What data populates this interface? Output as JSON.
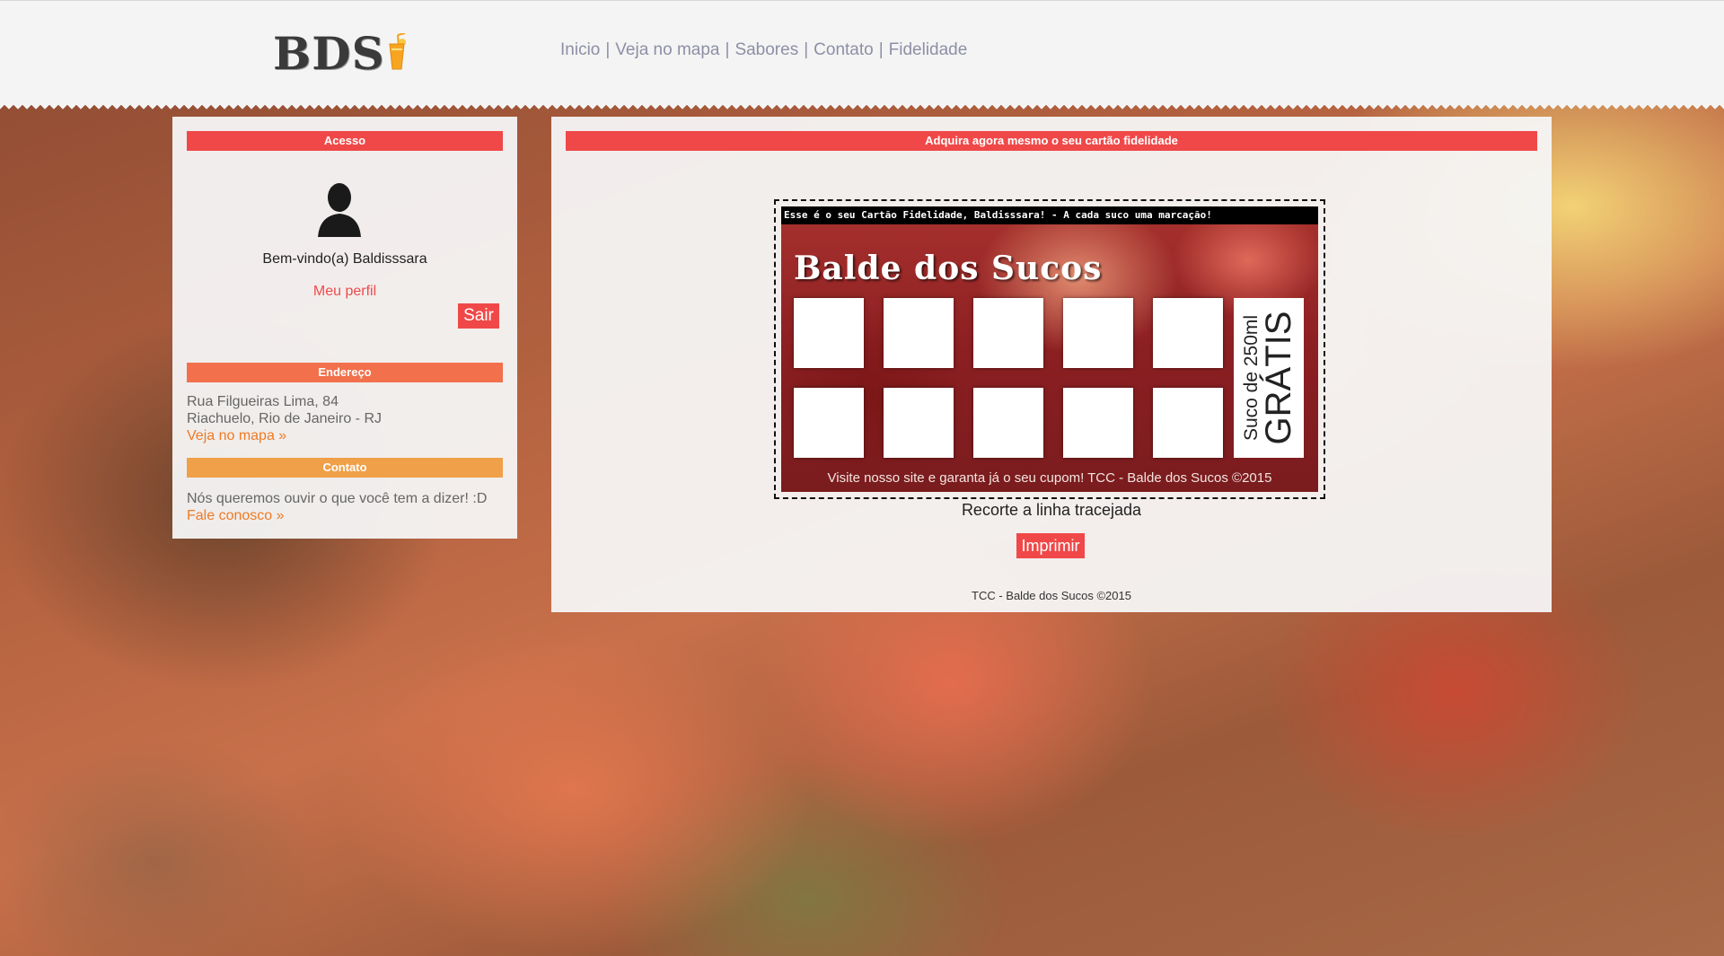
{
  "header": {
    "logo_text": "BDS",
    "nav": [
      {
        "label": "Inicio"
      },
      {
        "label": "Veja no mapa"
      },
      {
        "label": "Sabores"
      },
      {
        "label": "Contato"
      },
      {
        "label": "Fidelidade"
      }
    ],
    "separator": "|"
  },
  "sidebar": {
    "access_title": "Acesso",
    "welcome": "Bem-vindo(a) Baldisssara",
    "profile_link": "Meu perfil",
    "logout_button": "Sair",
    "address_title": "Endereço",
    "address_line1": "Rua Filgueiras Lima, 84",
    "address_line2": "Riachuelo, Rio de Janeiro - RJ",
    "map_link": "Veja no mapa »",
    "contact_title": "Contato",
    "contact_text": "Nós queremos ouvir o que você tem a dizer! :D",
    "contact_link": "Fale conosco »"
  },
  "main": {
    "title": "Adquira agora mesmo o seu cartão fidelidade",
    "card": {
      "header": "Esse é o seu Cartão Fidelidade, Baldisssara! - A cada suco uma marcação!",
      "brand": "Balde dos Sucos",
      "prize_small": "Suco de 250ml",
      "prize_big": "GRÁTIS",
      "footer": "Visite nosso site e garanta já o seu cupom! TCC - Balde dos Sucos ©2015",
      "stamps_total": 10,
      "stamps_marked": 0
    },
    "cut_text": "Recorte a linha tracejada",
    "print_button": "Imprimir",
    "footer": "TCC - Balde dos Sucos ©2015"
  },
  "colors": {
    "accent_red": "#f04848",
    "accent_coral": "#f2704c",
    "accent_orange": "#efa048",
    "link_orange": "#ef7a25",
    "nav_text": "#8d8fa6"
  }
}
